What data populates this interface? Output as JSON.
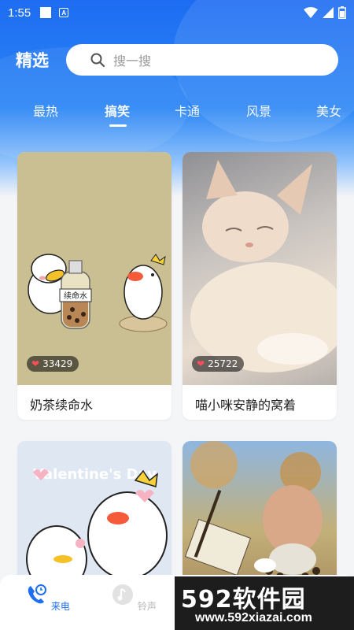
{
  "status_bar": {
    "time": "1:55",
    "a_label": "A"
  },
  "header": {
    "title": "精选"
  },
  "search": {
    "placeholder": "搜一搜"
  },
  "tabs": [
    {
      "label": "最热",
      "active": false
    },
    {
      "label": "搞笑",
      "active": true
    },
    {
      "label": "卡通",
      "active": false
    },
    {
      "label": "风景",
      "active": false
    },
    {
      "label": "美女",
      "active": false
    }
  ],
  "cards": [
    {
      "caption": "奶茶续命水",
      "likes": "33429",
      "bottle_text": "续命水"
    },
    {
      "caption": "喵小咪安静的窝着",
      "likes": "25722"
    },
    {
      "caption": "",
      "likes": "",
      "image_text": "Valentine's Day"
    },
    {
      "caption": "",
      "likes": ""
    }
  ],
  "bottom_nav": [
    {
      "label": "来电",
      "active": true
    },
    {
      "label": "铃声",
      "active": false
    }
  ],
  "watermark": {
    "brand": "592软件园",
    "url": "www.592xiazai.com"
  },
  "colors": {
    "primary": "#1e6ff1",
    "heart": "#ff4d5a"
  }
}
